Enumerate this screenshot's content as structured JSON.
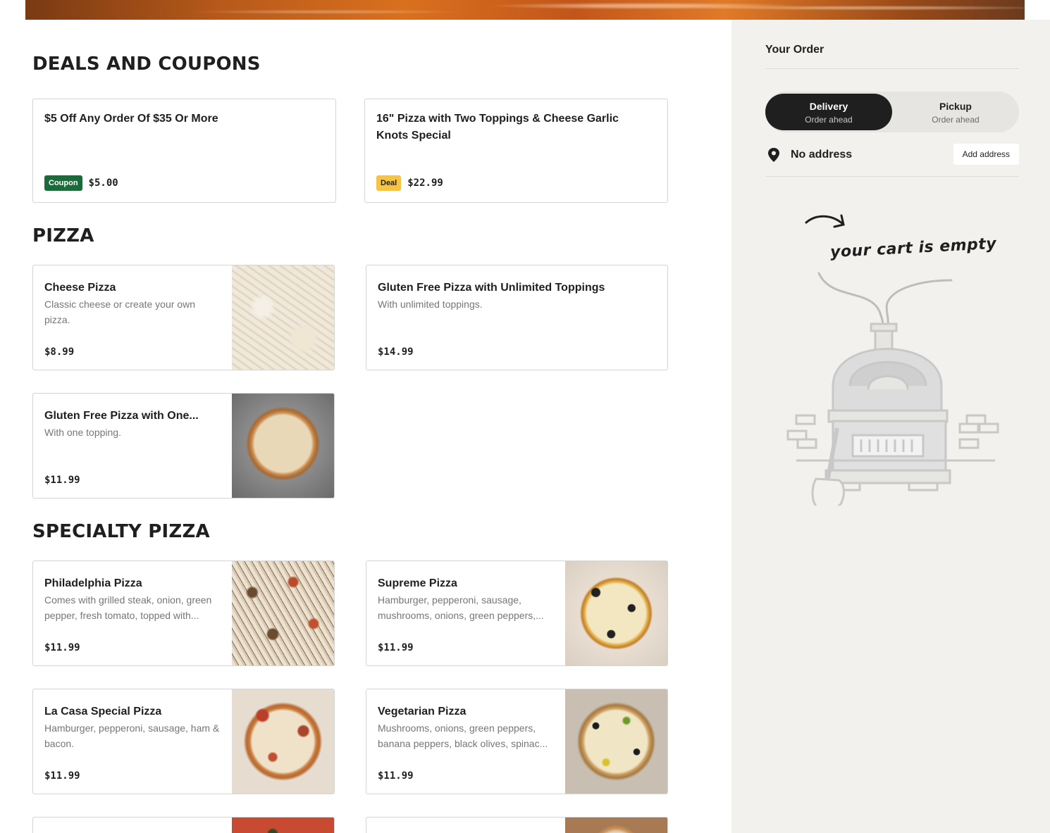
{
  "sections": {
    "deals_title": "DEALS AND COUPONS",
    "pizza_title": "PIZZA",
    "specialty_title": "SPECIALTY PIZZA"
  },
  "deals": [
    {
      "name": "$5 Off Any Order Of $35 Or More",
      "badge": "Coupon",
      "price": "$5.00"
    },
    {
      "name": "16\" Pizza with Two Toppings & Cheese Garlic Knots Special",
      "badge": "Deal",
      "price": "$22.99"
    }
  ],
  "pizza": [
    {
      "name": "Cheese Pizza",
      "desc": "Classic cheese or create your own pizza.",
      "price": "$8.99"
    },
    {
      "name": "Gluten Free Pizza with Unlimited Toppings",
      "desc": "With unlimited toppings.",
      "price": "$14.99"
    },
    {
      "name": "Gluten Free Pizza with One...",
      "desc": "With one topping.",
      "price": "$11.99"
    }
  ],
  "specialty": [
    {
      "name": "Philadelphia Pizza",
      "desc": "Comes with grilled steak, onion, green pepper, fresh tomato, topped with...",
      "price": "$11.99"
    },
    {
      "name": "Supreme Pizza",
      "desc": "Hamburger, pepperoni, sausage, mushrooms, onions, green peppers,...",
      "price": "$11.99"
    },
    {
      "name": "La Casa Special Pizza",
      "desc": "Hamburger, pepperoni, sausage, ham & bacon.",
      "price": "$11.99"
    },
    {
      "name": "Vegetarian Pizza",
      "desc": "Mushrooms, onions, green peppers, banana peppers, black olives, spinac...",
      "price": "$11.99"
    }
  ],
  "order": {
    "title": "Your Order",
    "delivery_label": "Delivery",
    "delivery_sub": "Order ahead",
    "pickup_label": "Pickup",
    "pickup_sub": "Order ahead",
    "address_text": "No address",
    "add_address_label": "Add address",
    "empty_cart_text": "your cart is empty"
  },
  "icons": {
    "location": "location-pin-icon",
    "arrow": "curved-arrow-icon",
    "oven": "pizza-oven-illustration"
  },
  "colors": {
    "coupon_badge": "#1b6a3a",
    "deal_badge": "#f6c445",
    "active_toggle": "#1f1f1f",
    "sidebar_bg": "#f2f1ee"
  }
}
